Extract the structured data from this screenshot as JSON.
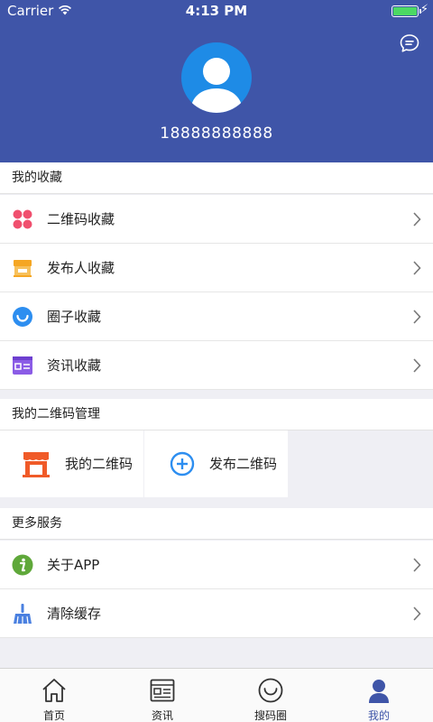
{
  "status_bar": {
    "carrier": "Carrier",
    "time": "4:13 PM"
  },
  "profile": {
    "username": "18888888888"
  },
  "favorites": {
    "title": "我的收藏",
    "items": [
      {
        "label": "二维码收藏",
        "icon": "clover-icon",
        "color": "#f0506e"
      },
      {
        "label": "发布人收藏",
        "icon": "store-icon",
        "color": "#f5a623"
      },
      {
        "label": "圈子收藏",
        "icon": "smile-icon",
        "color": "#2d8ef0"
      },
      {
        "label": "资讯收藏",
        "icon": "news-card-icon",
        "color": "#8b5ce6"
      }
    ]
  },
  "qr_management": {
    "title": "我的二维码管理",
    "items": [
      {
        "label": "我的二维码",
        "icon": "shop-icon",
        "color": "#f05a28"
      },
      {
        "label": "发布二维码",
        "icon": "plus-circle-icon",
        "color": "#2d8ef0"
      }
    ]
  },
  "more_services": {
    "title": "更多服务",
    "items": [
      {
        "label": "关于APP",
        "icon": "info-icon",
        "color": "#5fa83a"
      },
      {
        "label": "清除缓存",
        "icon": "broom-icon",
        "color": "#4a80e0"
      }
    ]
  },
  "tab_bar": {
    "tabs": [
      {
        "label": "首页",
        "icon": "home-icon",
        "active": false
      },
      {
        "label": "资讯",
        "icon": "news-icon",
        "active": false
      },
      {
        "label": "搜码圈",
        "icon": "circle-icon",
        "active": false
      },
      {
        "label": "我的",
        "icon": "person-icon",
        "active": true
      }
    ],
    "active_color": "#3f55a8"
  },
  "colors": {
    "header": "#3f55a8",
    "avatar": "#1e8be6",
    "background": "#efeff4"
  }
}
